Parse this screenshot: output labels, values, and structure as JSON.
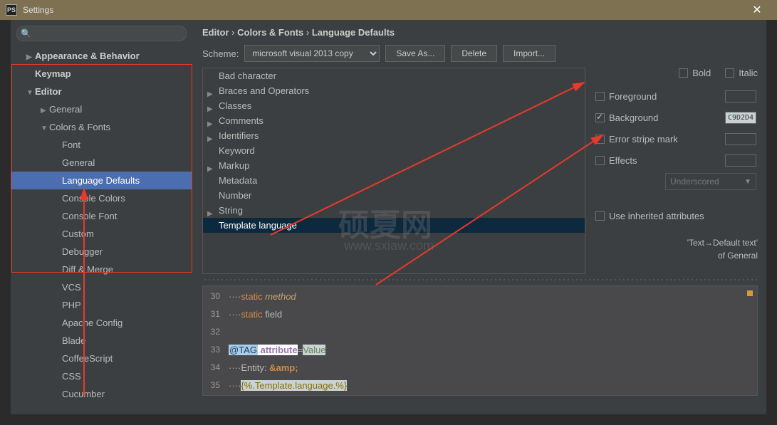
{
  "window": {
    "title": "Settings"
  },
  "search": {
    "placeholder": ""
  },
  "sidebar": {
    "items": [
      {
        "label": "Appearance & Behavior",
        "lvl": 1,
        "arrow": "▶",
        "bold": true
      },
      {
        "label": "Keymap",
        "lvl": 1,
        "bold": true
      },
      {
        "label": "Editor",
        "lvl": 1,
        "arrow": "▼",
        "bold": true
      },
      {
        "label": "General",
        "lvl": 2,
        "arrow": "▶"
      },
      {
        "label": "Colors & Fonts",
        "lvl": 2,
        "arrow": "▼"
      },
      {
        "label": "Font",
        "lvl": 3
      },
      {
        "label": "General",
        "lvl": 3
      },
      {
        "label": "Language Defaults",
        "lvl": 3,
        "sel": true
      },
      {
        "label": "Console Colors",
        "lvl": 3
      },
      {
        "label": "Console Font",
        "lvl": 3
      },
      {
        "label": "Custom",
        "lvl": 3
      },
      {
        "label": "Debugger",
        "lvl": 3
      },
      {
        "label": "Diff & Merge",
        "lvl": 3
      },
      {
        "label": "VCS",
        "lvl": 3
      },
      {
        "label": "PHP",
        "lvl": 3
      },
      {
        "label": "Apache Config",
        "lvl": 3
      },
      {
        "label": "Blade",
        "lvl": 3
      },
      {
        "label": "CoffeeScript",
        "lvl": 3
      },
      {
        "label": "CSS",
        "lvl": 3
      },
      {
        "label": "Cucumber",
        "lvl": 3
      }
    ]
  },
  "breadcrumb": {
    "p1": "Editor",
    "p2": "Colors & Fonts",
    "p3": "Language Defaults"
  },
  "scheme": {
    "label": "Scheme:",
    "value": "microsoft visual 2013 copy",
    "saveas": "Save As...",
    "delete": "Delete",
    "import": "Import..."
  },
  "categories": [
    {
      "label": "Bad character"
    },
    {
      "label": "Braces and Operators",
      "tri": true
    },
    {
      "label": "Classes",
      "tri": true
    },
    {
      "label": "Comments",
      "tri": true
    },
    {
      "label": "Identifiers",
      "tri": true
    },
    {
      "label": "Keyword"
    },
    {
      "label": "Markup",
      "tri": true
    },
    {
      "label": "Metadata"
    },
    {
      "label": "Number"
    },
    {
      "label": "String",
      "tri": true
    },
    {
      "label": "Template language",
      "sel": true
    }
  ],
  "attrs": {
    "bold": "Bold",
    "italic": "Italic",
    "fg": "Foreground",
    "bg": "Background",
    "bgval": "C9D2D4",
    "stripe": "Error stripe mark",
    "effects": "Effects",
    "effval": "Underscored",
    "inh": "Use inherited attributes",
    "inhtext": "'Text→Default text'",
    "of": "of ",
    "glink": "General"
  },
  "code": {
    "ln": [
      "30",
      "31",
      "32",
      "33",
      "34",
      "35"
    ]
  },
  "watermark": {
    "t1": "硕夏网",
    "t2": "www.sxiaw.com"
  }
}
